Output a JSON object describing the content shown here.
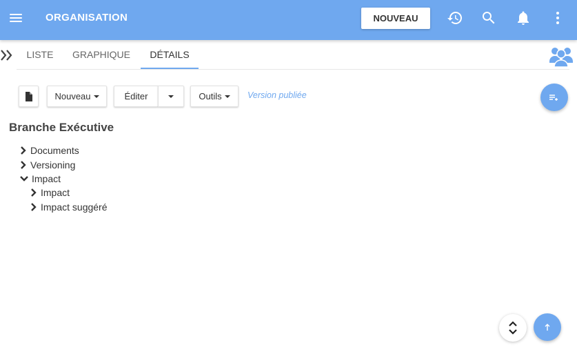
{
  "header": {
    "menu_icon": "hamburger-menu-icon",
    "title": "ORGANISATION",
    "new_button": "NOUVEAU",
    "icons": [
      "history-icon",
      "search-icon",
      "bell-icon",
      "more-vertical-icon"
    ],
    "bar_color": "#6fa8ef"
  },
  "tabs": [
    {
      "label": "LISTE",
      "active": false
    },
    {
      "label": "GRAPHIQUE",
      "active": false
    },
    {
      "label": "DÉTAILS",
      "active": true
    }
  ],
  "toolbar": {
    "document_icon": "document-icon",
    "new_label": "Nouveau",
    "edit_label": "Éditer",
    "tools_label": "Outils",
    "version_status": "Version publiée"
  },
  "details": {
    "title": "Branche Exécutive",
    "tree": [
      {
        "label": "Documents",
        "expanded": false,
        "level": 0
      },
      {
        "label": "Versioning",
        "expanded": false,
        "level": 0
      },
      {
        "label": "Impact",
        "expanded": true,
        "level": 0
      },
      {
        "label": "Impact",
        "expanded": false,
        "level": 1
      },
      {
        "label": "Impact suggéré",
        "expanded": false,
        "level": 1
      }
    ]
  },
  "fab": {
    "top_icon": "add-to-list-icon",
    "scroll_icon": "expand-collapse-icon",
    "up_icon": "arrow-up-icon"
  }
}
